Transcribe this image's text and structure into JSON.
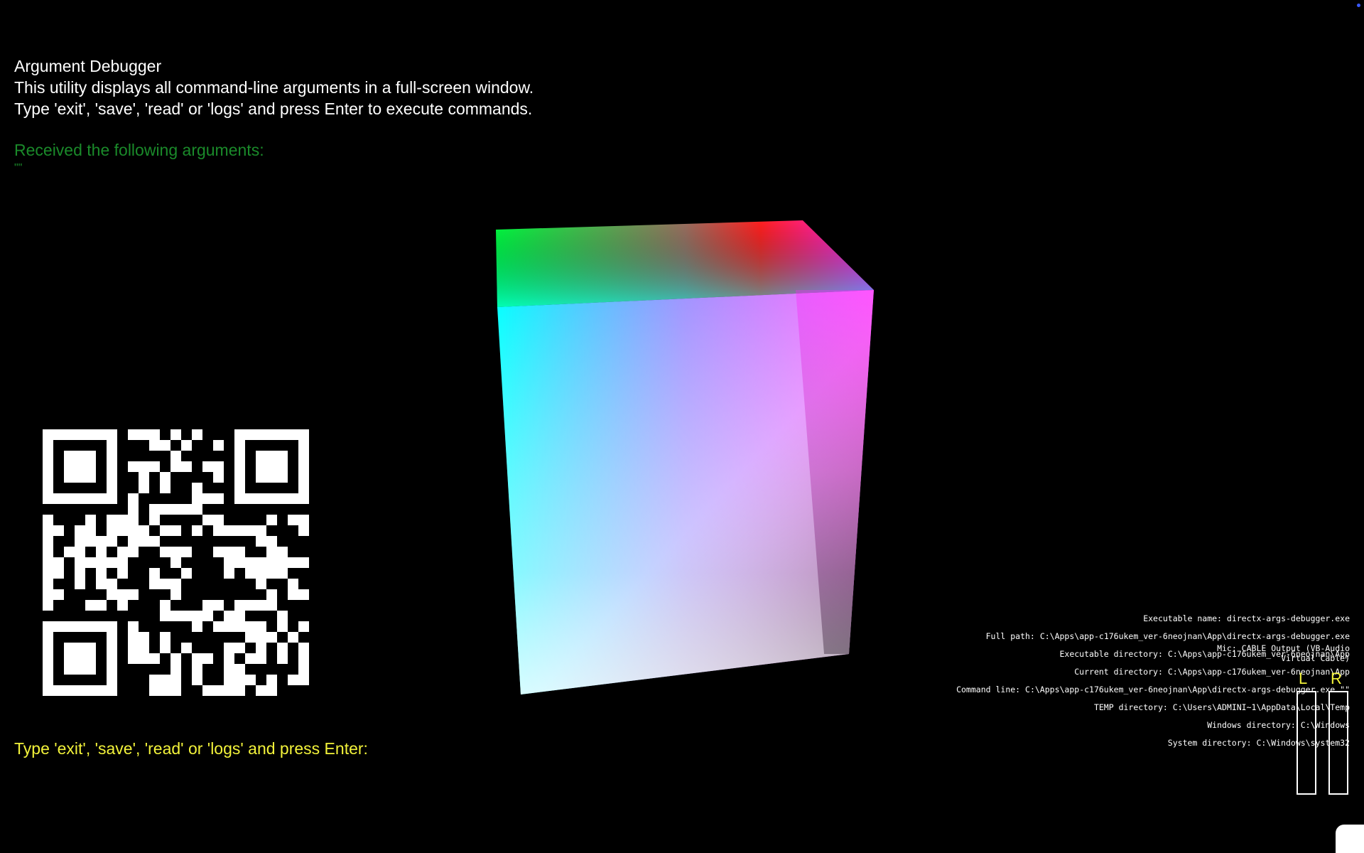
{
  "header": {
    "title": "Argument Debugger",
    "description": "This utility displays all command-line arguments in a full-screen window.",
    "instructions": "Type 'exit', 'save', 'read' or 'logs' and press Enter to execute commands."
  },
  "arguments": {
    "title": "Received the following arguments:",
    "value": "\"\""
  },
  "prompt": {
    "text": "Type 'exit', 'save', 'read' or 'logs' and press Enter:"
  },
  "info": [
    {
      "label": "Executable name:",
      "value": "directx-args-debugger.exe"
    },
    {
      "label": "Full path:",
      "value": "C:\\Apps\\app-c176ukem_ver-6neojnan\\App\\directx-args-debugger.exe"
    },
    {
      "label": "Executable directory:",
      "value": "C:\\Apps\\app-c176ukem_ver-6neojnan\\App"
    },
    {
      "label": "Current directory:",
      "value": "C:\\Apps\\app-c176ukem_ver-6neojnan\\App"
    },
    {
      "label": "Command line:",
      "value": "C:\\Apps\\app-c176ukem_ver-6neojnan\\App\\directx-args-debugger.exe \"\""
    },
    {
      "label": "TEMP directory:",
      "value": "C:\\Users\\ADMINI~1\\AppData\\Local\\Temp"
    },
    {
      "label": "Windows directory:",
      "value": "C:\\Windows"
    },
    {
      "label": "System directory:",
      "value": "C:\\Windows\\system32"
    }
  ],
  "mic": {
    "line1": "Mic: CABLE Output (VB-Audio",
    "line2": "Virtual Cable)"
  },
  "meters": {
    "left_label": "L",
    "right_label": "R",
    "left_level": 0,
    "right_level": 0
  },
  "colors": {
    "background": "#000000",
    "arguments_text": "#1a8a2a",
    "prompt_text": "#f2f23a",
    "meter_label": "#f2f23a"
  },
  "icons": {
    "qr": "qr-code",
    "cube": "rgb-cube-render"
  }
}
